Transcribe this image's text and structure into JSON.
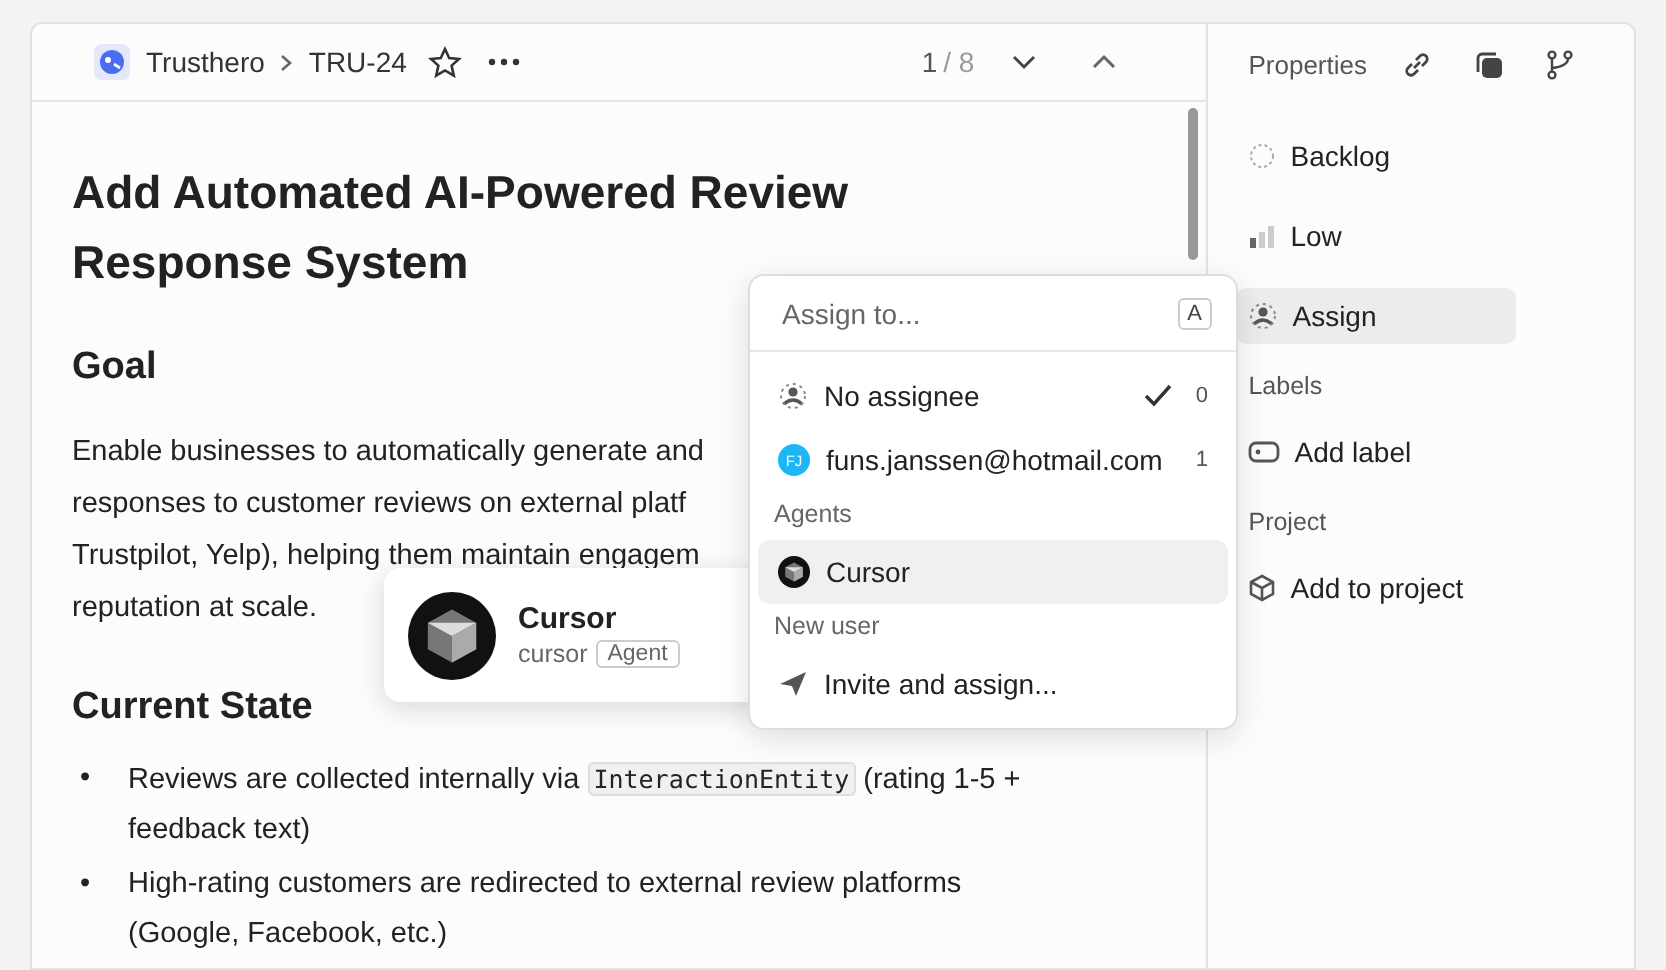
{
  "breadcrumb": {
    "team": "Trusthero",
    "issue": "TRU-24",
    "starred": false
  },
  "pager": {
    "current": "1",
    "total": "/ 8"
  },
  "title_lines": [
    "Add Automated AI-Powered Review",
    "Response System"
  ],
  "sections": [
    {
      "heading": "Goal",
      "kind": "paragraph",
      "lines": [
        "Enable businesses to automatically generate and",
        "responses to customer reviews on external platf",
        "Trustpilot, Yelp), helping them maintain engagem",
        "reputation at scale."
      ]
    },
    {
      "heading": "Current State",
      "kind": "bullets",
      "marker": "•",
      "items": [
        {
          "before": "Reviews are collected internally via ",
          "code": "InteractionEntity",
          "after": " (rating 1-5 + feedback text)"
        },
        {
          "before": "High-rating customers are redirected to external review platforms (Google, Facebook, etc.)"
        }
      ]
    }
  ],
  "properties": {
    "title": "Properties",
    "items": [
      {
        "kind": "status",
        "label": "Backlog",
        "highlighted": false
      },
      {
        "kind": "priority",
        "label": "Low",
        "highlighted": false
      },
      {
        "kind": "assignee",
        "label": "Assign",
        "highlighted": true
      }
    ],
    "groups": [
      {
        "title": "Labels",
        "kind": "label",
        "action": "Add label"
      },
      {
        "title": "Project",
        "kind": "project",
        "action": "Add to project"
      }
    ]
  },
  "assign_menu": {
    "placeholder": "Assign to...",
    "shortcut": "A",
    "groups": [
      {
        "options": [
          {
            "kind": "none",
            "label": "No assignee",
            "selected": true,
            "key": "0"
          },
          {
            "kind": "user",
            "initials": "FJ",
            "color": "#1cb8f5",
            "label": "funs.janssen@hotmail.com",
            "selected": false,
            "key": "1"
          }
        ]
      },
      {
        "title": "Agents",
        "options": [
          {
            "kind": "agent",
            "label": "Cursor",
            "selected": false,
            "hovered": true
          }
        ]
      },
      {
        "title": "New user",
        "options": [
          {
            "kind": "invite",
            "label": "Invite and assign...",
            "selected": false
          }
        ]
      }
    ]
  },
  "hover_card": {
    "name": "Cursor",
    "handle": "cursor",
    "badge": "Agent"
  }
}
